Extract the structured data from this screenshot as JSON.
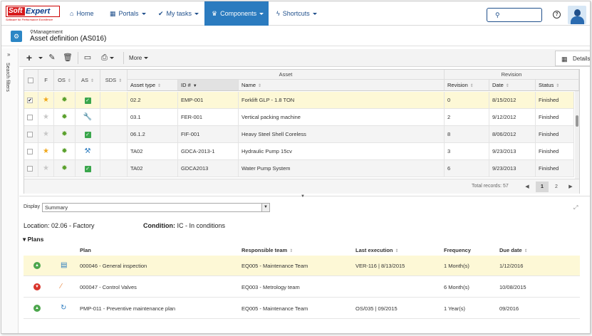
{
  "logo": {
    "soft": "Soft",
    "expert": "Expert",
    "tagline": "Software for Performance Excellence"
  },
  "nav": {
    "home": "Home",
    "portals": "Portals",
    "my_tasks": "My tasks",
    "components": "Components",
    "shortcuts": "Shortcuts"
  },
  "header": {
    "breadcrumb": "Management",
    "title": "Asset definition (AS016)"
  },
  "side_panel": {
    "label": "Search filters"
  },
  "toolbar": {
    "more": "More",
    "details": "Details"
  },
  "grid": {
    "group_asset": "Asset",
    "group_revision": "Revision",
    "columns": {
      "f": "F",
      "os": "OS",
      "as": "AS",
      "sds": "SDS",
      "asset_type": "Asset type",
      "id": "ID #",
      "name": "Name",
      "revision": "Revision",
      "date": "Date",
      "status": "Status"
    },
    "rows": [
      {
        "checked": "✔",
        "starred": true,
        "as_icon": "check",
        "asset_type": "02.2",
        "id": "EMP-001",
        "name": "Forklift GLP - 1.8 TON",
        "revision": "0",
        "date": "8/15/2012",
        "status": "Finished"
      },
      {
        "checked": "",
        "starred": false,
        "as_icon": "wrench",
        "asset_type": "03.1",
        "id": "FER-001",
        "name": "Vertical packing machine",
        "revision": "2",
        "date": "9/12/2012",
        "status": "Finished"
      },
      {
        "checked": "",
        "starred": false,
        "as_icon": "check",
        "asset_type": "06.1.2",
        "id": "FIF-001",
        "name": "Heavy Steel Shell Coreless",
        "revision": "8",
        "date": "8/06/2012",
        "status": "Finished"
      },
      {
        "checked": "",
        "starred": true,
        "as_icon": "tools",
        "asset_type": "TA02",
        "id": "GDCA-2013-1",
        "name": "Hydraulic Pump 15cv",
        "revision": "3",
        "date": "9/23/2013",
        "status": "Finished"
      },
      {
        "checked": "",
        "starred": false,
        "as_icon": "check",
        "asset_type": "TA02",
        "id": "GDCA2013",
        "name": "Water Pump System",
        "revision": "6",
        "date": "9/23/2013",
        "status": "Finished"
      }
    ],
    "total_records": "Total records: 57",
    "pages": [
      "1",
      "2"
    ],
    "current_page": "1"
  },
  "display": {
    "label": "Display",
    "value": "Summary"
  },
  "location": {
    "label": "Location:",
    "value": "Location: 02.06 - Factory"
  },
  "condition": {
    "label": "Condition:",
    "value": "IC - In conditions"
  },
  "plans": {
    "title": "Plans",
    "columns": {
      "plan": "Plan",
      "team": "Responsible team",
      "last": "Last execution",
      "frequency": "Frequency",
      "due": "Due date"
    },
    "rows": [
      {
        "trend": "up",
        "plan": "000046 - General inspection",
        "team": "EQ005 - Maintenance Team",
        "last": "VER-116 | 8/13/2015",
        "frequency": "1 Month(s)",
        "due": "1/12/2016"
      },
      {
        "trend": "down",
        "plan": "000047 - Control Valves",
        "team": "EQ003 - Metrology team",
        "last": "",
        "frequency": "6 Month(s)",
        "due": "10/08/2015"
      },
      {
        "trend": "up",
        "plan": "PMP-011 - Preventive maintenance plan",
        "team": "EQ005 - Maintenance Team",
        "last": "OS/035 | 09/2015",
        "frequency": "1 Year(s)",
        "due": "09/2016"
      }
    ]
  },
  "colors": {
    "brand_red": "#d7191c",
    "nav_blue": "#1f4f8b",
    "active_tab": "#2b7bbf",
    "selected_row": "#fdf8d6",
    "ok_green": "#3aa64c"
  }
}
